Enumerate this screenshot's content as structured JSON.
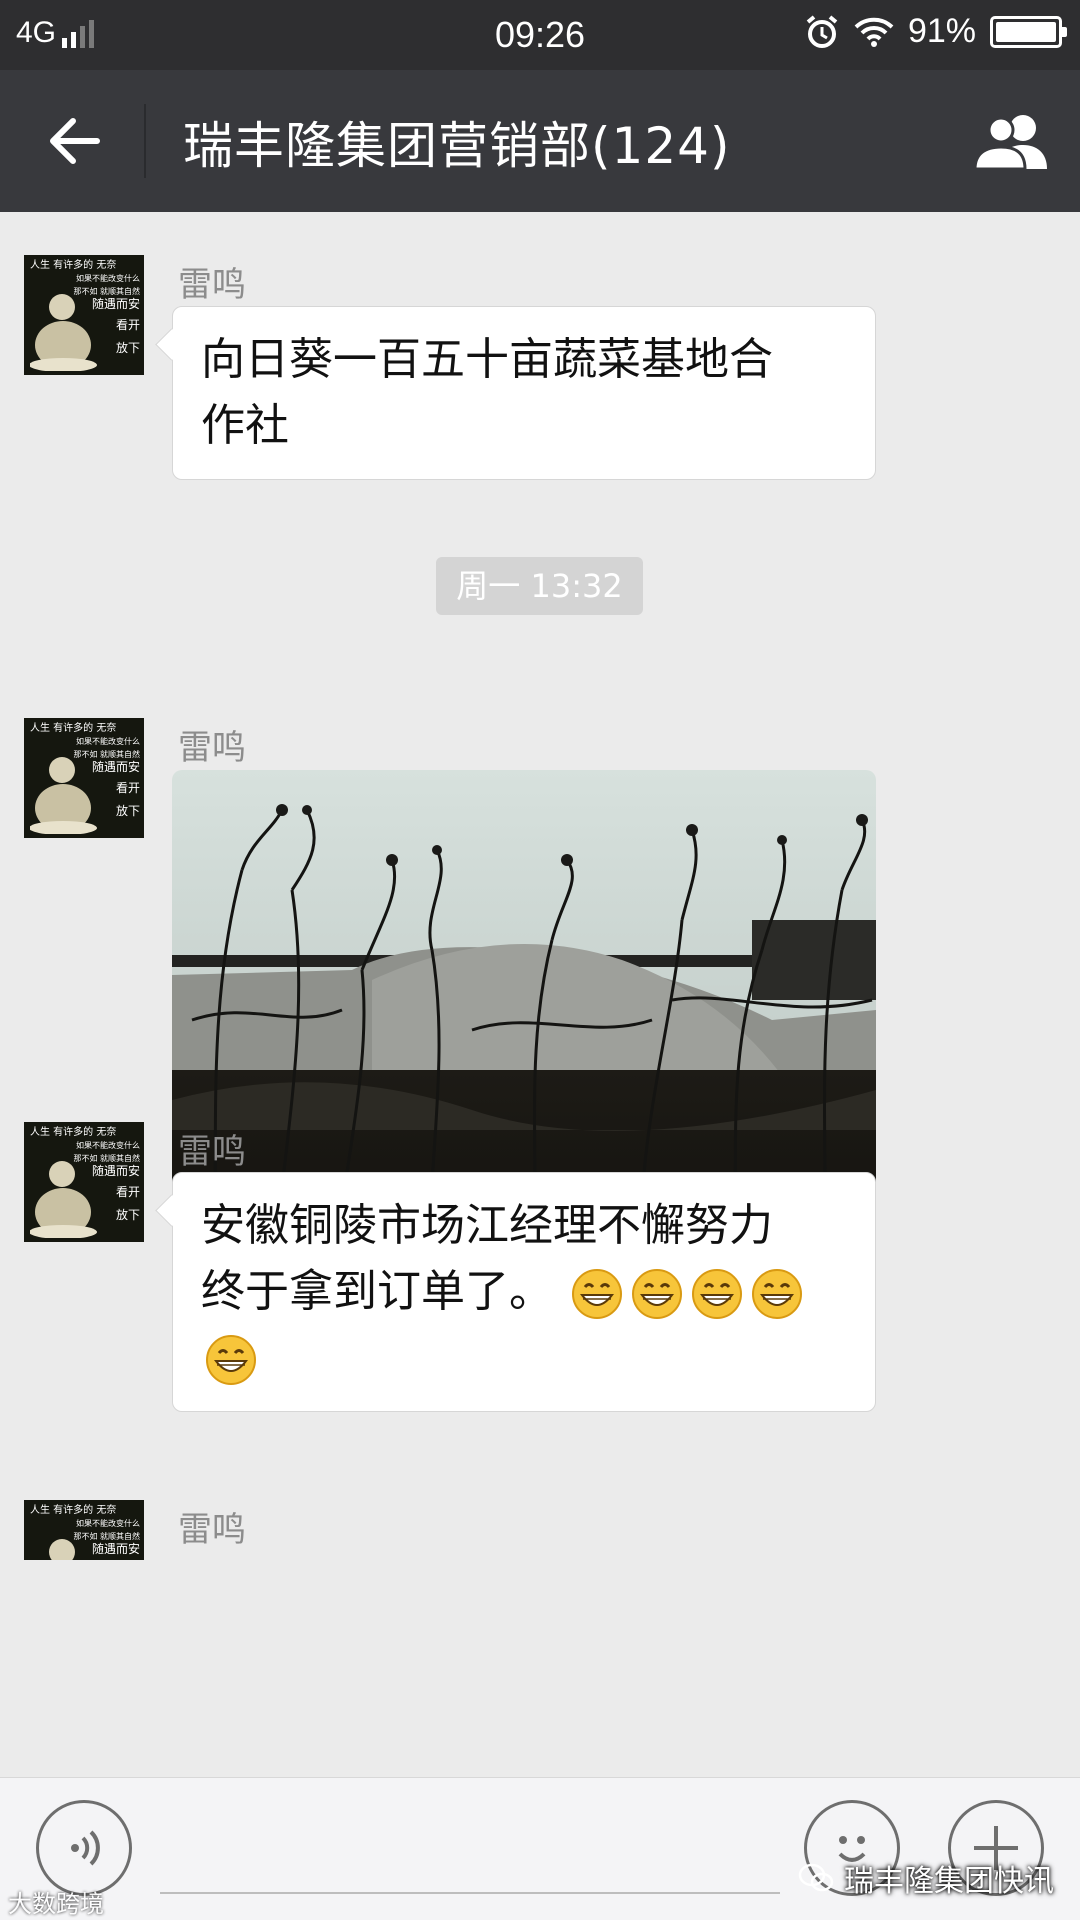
{
  "status_bar": {
    "network": "4G",
    "time": "09:26",
    "battery": "91%"
  },
  "header": {
    "title": "瑞丰隆集团营销部(124)"
  },
  "messages": [
    {
      "sender": "雷鸣",
      "text_line1": "向日葵一百五十亩蔬菜基地合",
      "text_line2": "作社"
    },
    {
      "sender": "雷鸣",
      "image_icon": "greenhouse-photo"
    },
    {
      "sender": "雷鸣",
      "text_line1": "安徽铜陵市场江经理不懈努力",
      "text_line2": "终于拿到订单了。",
      "emoji": "grinning-face-icon",
      "emoji_count": 5
    },
    {
      "sender": "雷鸣"
    }
  ],
  "time_divider": "周一 13:32",
  "avatar_text": {
    "l1": "人生 有许多的 无奈",
    "l2": "如果不能改变什么",
    "l3": "那不如 就顺其自然",
    "l4": "随遇而安",
    "l5": "看开",
    "l6": "放下"
  },
  "watermark": {
    "right": "瑞丰隆集团快讯",
    "left": "大数跨境"
  },
  "colors": {
    "nav_bg": "#38393d",
    "status_bg": "#2e2e30",
    "chat_bg": "#ebebeb"
  }
}
